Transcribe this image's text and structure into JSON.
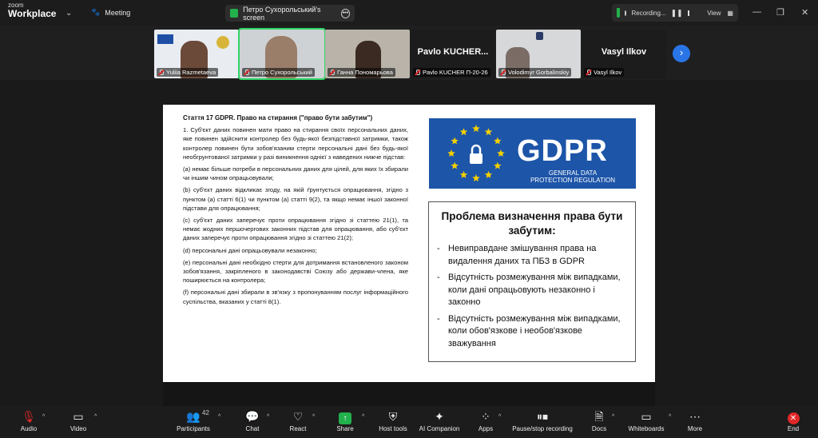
{
  "app": {
    "brand_small": "zoom",
    "brand_big": "Workplace",
    "meeting_label": "Meeting"
  },
  "share_pill": {
    "label": "Петро Сухорольський's screen"
  },
  "recording": {
    "label": "Recording...",
    "view_label": "View"
  },
  "participants_strip": [
    {
      "name": "Yuliia Razmetaeva",
      "type": "video",
      "muted": true
    },
    {
      "name": "Петро Сухорольський",
      "type": "video",
      "muted": true,
      "active": true
    },
    {
      "name": "Ганна Пономарьова",
      "type": "video",
      "muted": true
    },
    {
      "name": "Pavlo KUCHER П-20-26",
      "type": "name",
      "display": "Pavlo KUCHER...",
      "muted": true
    },
    {
      "name": "Volodimyr Gorbalinskiy",
      "type": "video",
      "muted": true
    },
    {
      "name": "Vasyl Ilkov",
      "type": "name",
      "display": "Vasyl Ilkov",
      "muted": true
    }
  ],
  "slide": {
    "article_title": "Стаття 17 GDPR. Право на стирання (\"право бути забутим\")",
    "paragraphs": [
      "1. Суб'єкт даних повинен мати право на стирання своїх персональних даних, яке повинен здійснити контролер без будь-якої безпідставної затримки, також контролер повинен бути зобов'язаним стерти персональні дані без будь-якої необгрунтованої затримки у разі виникнення однієї з наведених нижче підстав:",
      "(a) немає більше потреби в персональних даних для цілей, для яких їх збирали чи іншим чином опрацьовували;",
      "(b) суб'єкт даних відкликає згоду, на якій ґрунтується опрацювання, згідно з пунктом (a) статті 6(1) чи пунктом (a) статті 9(2), та якщо немає іншої законної підстави для опрацювання;",
      "(c) суб'єкт даних заперечує проти опрацювання згідно зі статтею 21(1), та немає жодних першочергових законних підстав для опрацювання, або суб'єкт даних заперечує проти опрацювання згідно зі статтею 21(2);",
      "(d) персональні дані опрацьовували незаконно;",
      "(e) персональні дані необхідно стерти для дотримання встановленого законом зобов'язання, закріпленого в законодавстві Союзу або держави-члена, яке поширюється на контролера;",
      "(f) персональні дані збирали в зв'язку з пропонуванням послуг інформаційного суспільства, вказаних у статті 8(1)."
    ],
    "banner_word": "GDPR",
    "banner_sub_1": "GENERAL DATA",
    "banner_sub_2": "PROTECTION REGULATION",
    "problem_title": "Проблема визначення права бути забутим:",
    "problem_items": [
      "Невиправдане змішування права на видалення даних та ПБЗ в GDPR",
      "Відсутність розмежування між випадками, коли дані опрацьовують незаконно і законно",
      "Відсутність розмежування між випадками, коли обов'язкове і необов'язкове зважування"
    ]
  },
  "toolbar": {
    "audio": "Audio",
    "video": "Video",
    "participants": "Participants",
    "participants_count": "42",
    "chat": "Chat",
    "react": "React",
    "share": "Share",
    "host_tools": "Host tools",
    "ai_companion": "AI Companion",
    "apps": "Apps",
    "pause_recording": "Pause/stop recording",
    "docs": "Docs",
    "whiteboards": "Whiteboards",
    "more": "More",
    "end": "End"
  },
  "colors": {
    "accent_green": "#22b14c",
    "end_red": "#e02828",
    "nav_blue": "#2a75e6",
    "gdpr_blue": "#1d55a8",
    "star_yellow": "#f5d000"
  }
}
